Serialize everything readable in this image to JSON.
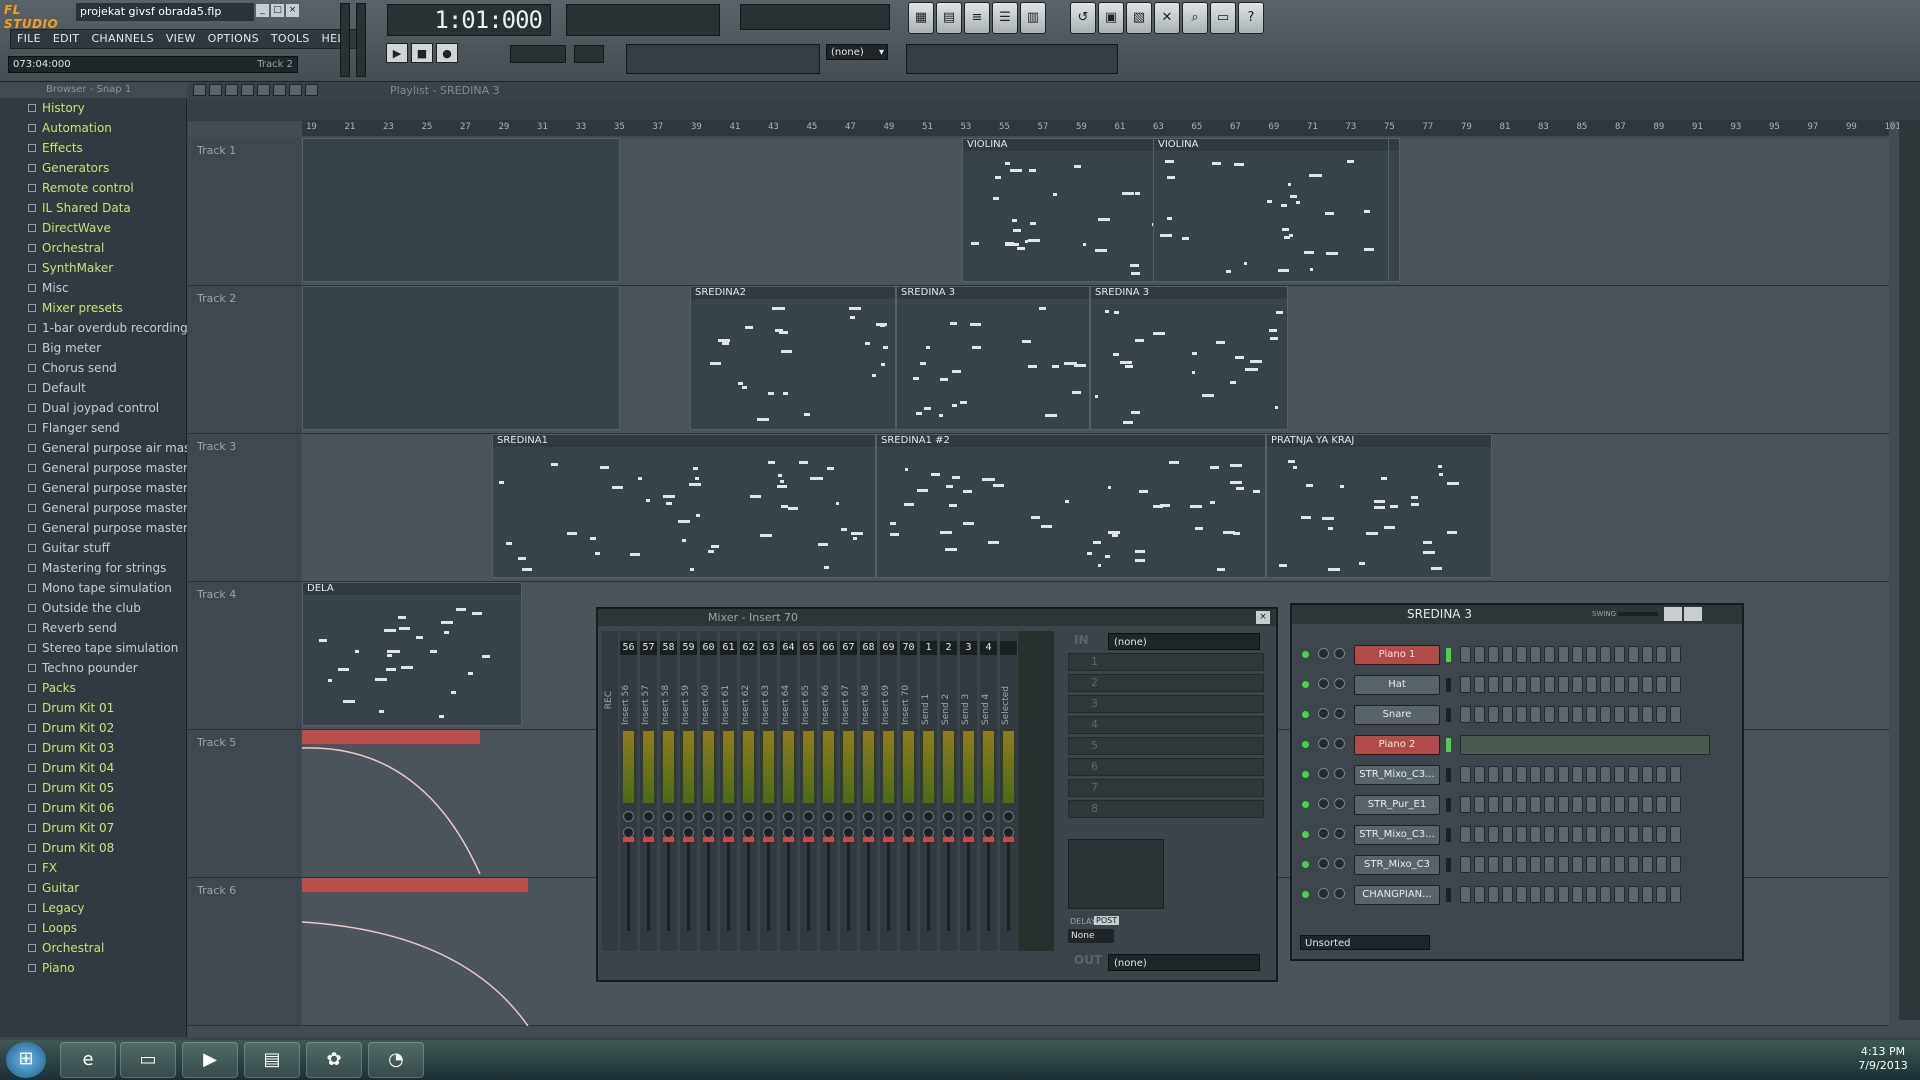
{
  "app": {
    "logo": "FL STUDIO",
    "file_title": "projekat givsf obrada5.flp",
    "window_buttons": [
      "_",
      "□",
      "×"
    ]
  },
  "menu": [
    "FILE",
    "EDIT",
    "CHANNELS",
    "VIEW",
    "OPTIONS",
    "TOOLS",
    "HELP"
  ],
  "hint_bar": {
    "value": "073:04:000",
    "track": "Track 2"
  },
  "clock": "1:01:000",
  "transport": {
    "play": "▶",
    "stop": "■",
    "record": "●"
  },
  "pattern_none": "(none)",
  "toolbar_icons": [
    "step-sequencer-icon",
    "piano-roll-icon",
    "playlist-icon",
    "browser-icon",
    "mixer-icon",
    "undo-icon",
    "save-icon",
    "render-icon",
    "plugin-icon",
    "search-icon",
    "project-icon",
    "help-icon"
  ],
  "browser": {
    "title": "Browser - Snap 1",
    "items": [
      {
        "label": "History",
        "type": "folder"
      },
      {
        "label": "Automation",
        "type": "folder"
      },
      {
        "label": "Effects",
        "type": "folder"
      },
      {
        "label": "Generators",
        "type": "folder"
      },
      {
        "label": "Remote control",
        "type": "folder"
      },
      {
        "label": "IL Shared Data",
        "type": "folder"
      },
      {
        "label": "DirectWave",
        "type": "folder"
      },
      {
        "label": "Orchestral",
        "type": "folder"
      },
      {
        "label": "SynthMaker",
        "type": "folder"
      },
      {
        "label": "Misc",
        "type": "item"
      },
      {
        "label": "Mixer presets",
        "type": "sel"
      },
      {
        "label": "1-bar overdub recording",
        "type": "item"
      },
      {
        "label": "Big meter",
        "type": "item"
      },
      {
        "label": "Chorus send",
        "type": "item"
      },
      {
        "label": "Default",
        "type": "item"
      },
      {
        "label": "Dual joypad control",
        "type": "item"
      },
      {
        "label": "Flanger send",
        "type": "item"
      },
      {
        "label": "General purpose air mas...",
        "type": "item"
      },
      {
        "label": "General purpose master...",
        "type": "item"
      },
      {
        "label": "General purpose master...",
        "type": "item"
      },
      {
        "label": "General purpose master...",
        "type": "item"
      },
      {
        "label": "General purpose master...",
        "type": "item"
      },
      {
        "label": "Guitar stuff",
        "type": "item"
      },
      {
        "label": "Mastering for strings",
        "type": "item"
      },
      {
        "label": "Mono tape simulation",
        "type": "item"
      },
      {
        "label": "Outside the club",
        "type": "item"
      },
      {
        "label": "Reverb send",
        "type": "item"
      },
      {
        "label": "Stereo tape simulation",
        "type": "item"
      },
      {
        "label": "Techno pounder",
        "type": "item"
      },
      {
        "label": "Packs",
        "type": "folder"
      },
      {
        "label": "Drum Kit 01",
        "type": "folder"
      },
      {
        "label": "Drum Kit 02",
        "type": "folder"
      },
      {
        "label": "Drum Kit 03",
        "type": "folder"
      },
      {
        "label": "Drum Kit 04",
        "type": "folder"
      },
      {
        "label": "Drum Kit 05",
        "type": "folder"
      },
      {
        "label": "Drum Kit 06",
        "type": "folder"
      },
      {
        "label": "Drum Kit 07",
        "type": "folder"
      },
      {
        "label": "Drum Kit 08",
        "type": "folder"
      },
      {
        "label": "FX",
        "type": "folder"
      },
      {
        "label": "Guitar",
        "type": "folder"
      },
      {
        "label": "Legacy",
        "type": "folder"
      },
      {
        "label": "Loops",
        "type": "folder"
      },
      {
        "label": "Orchestral",
        "type": "folder"
      },
      {
        "label": "Piano",
        "type": "folder"
      }
    ]
  },
  "playlist": {
    "title": "Playlist - SREDINA 3",
    "ruler": [
      "19",
      "21",
      "23",
      "25",
      "27",
      "29",
      "31",
      "33",
      "35",
      "37",
      "39",
      "41",
      "43",
      "45",
      "47",
      "49",
      "51",
      "53",
      "55",
      "57",
      "59",
      "61",
      "63",
      "65",
      "67",
      "69",
      "71",
      "73",
      "75",
      "77",
      "79",
      "81",
      "83",
      "85",
      "87",
      "89",
      "91",
      "93",
      "95",
      "97",
      "99",
      "101"
    ],
    "tracks": [
      "Track 1",
      "Track 2",
      "Track 3",
      "Track 4",
      "Track 5",
      "Track 6"
    ],
    "clips": [
      {
        "track": 0,
        "label": "VIOLINA"
      },
      {
        "track": 0,
        "label": "VIOLINA"
      },
      {
        "track": 1,
        "label": "SREDINA2"
      },
      {
        "track": 1,
        "label": "SREDINA 3"
      },
      {
        "track": 1,
        "label": "SREDINA 3"
      },
      {
        "track": 2,
        "label": "SREDINA1"
      },
      {
        "track": 2,
        "label": "SREDINA1 #2"
      },
      {
        "track": 2,
        "label": "PRATNJA YA KRAJ"
      },
      {
        "track": 3,
        "label": "DELA"
      }
    ]
  },
  "mixer": {
    "title": "Mixer - Insert 70",
    "rec_label": "REC",
    "strips": [
      {
        "num": "56",
        "name": "Insert 56"
      },
      {
        "num": "57",
        "name": "Insert 57"
      },
      {
        "num": "58",
        "name": "Insert 58"
      },
      {
        "num": "59",
        "name": "Insert 59"
      },
      {
        "num": "60",
        "name": "Insert 60"
      },
      {
        "num": "61",
        "name": "Insert 61"
      },
      {
        "num": "62",
        "name": "Insert 62"
      },
      {
        "num": "63",
        "name": "Insert 63"
      },
      {
        "num": "64",
        "name": "Insert 64"
      },
      {
        "num": "65",
        "name": "Insert 65"
      },
      {
        "num": "66",
        "name": "Insert 66"
      },
      {
        "num": "67",
        "name": "Insert 67"
      },
      {
        "num": "68",
        "name": "Insert 68"
      },
      {
        "num": "69",
        "name": "Insert 69"
      },
      {
        "num": "70",
        "name": "Insert 70"
      },
      {
        "num": "1",
        "name": "Send 1"
      },
      {
        "num": "2",
        "name": "Send 2"
      },
      {
        "num": "3",
        "name": "Send 3"
      },
      {
        "num": "4",
        "name": "Send 4"
      },
      {
        "num": "",
        "name": "Selected"
      }
    ],
    "in_label": "IN",
    "in_value": "(none)",
    "out_label": "OUT",
    "out_value": "(none)",
    "fx_slots": [
      "1",
      "2",
      "3",
      "4",
      "5",
      "6",
      "7",
      "8"
    ],
    "delay_label": "DELAY",
    "post_label": "POST",
    "delay_value": "None"
  },
  "rack": {
    "title": "SREDINA 3",
    "swing_label": "SWING",
    "channels": [
      {
        "name": "Piano 1",
        "active": true,
        "pattern": [
          0,
          0,
          0,
          0,
          0,
          0,
          0,
          0,
          0,
          0,
          0,
          0,
          0,
          0,
          0,
          0
        ]
      },
      {
        "name": "Hat",
        "active": false,
        "pattern": [
          0,
          0,
          0,
          0,
          0,
          0,
          0,
          0,
          0,
          0,
          0,
          0,
          0,
          0,
          0,
          0
        ]
      },
      {
        "name": "Snare",
        "active": false,
        "pattern": [
          0,
          0,
          0,
          0,
          0,
          0,
          0,
          0,
          0,
          0,
          0,
          0,
          0,
          0,
          0,
          0
        ]
      },
      {
        "name": "Piano 2",
        "active": true,
        "pattern": null
      },
      {
        "name": "STR_Mixo_C3...",
        "active": false,
        "pattern": [
          0,
          0,
          0,
          0,
          0,
          0,
          0,
          0,
          0,
          0,
          0,
          0,
          0,
          0,
          0,
          0
        ]
      },
      {
        "name": "STR_Pur_E1",
        "active": false,
        "pattern": [
          0,
          0,
          0,
          0,
          0,
          0,
          0,
          0,
          0,
          0,
          0,
          0,
          0,
          0,
          0,
          0
        ]
      },
      {
        "name": "STR_Mixo_C3...",
        "active": false,
        "pattern": [
          0,
          0,
          0,
          0,
          0,
          0,
          0,
          0,
          0,
          0,
          0,
          0,
          0,
          0,
          0,
          0
        ]
      },
      {
        "name": "STR_Mixo_C3",
        "active": false,
        "pattern": [
          0,
          0,
          0,
          0,
          0,
          0,
          0,
          0,
          0,
          0,
          0,
          0,
          0,
          0,
          0,
          0
        ]
      },
      {
        "name": "CHANGPIAN...",
        "active": false,
        "pattern": [
          0,
          0,
          0,
          0,
          0,
          0,
          0,
          0,
          0,
          0,
          0,
          0,
          0,
          0,
          0,
          0
        ]
      }
    ],
    "filter": "Unsorted"
  },
  "taskbar": {
    "apps": [
      "windows-start-icon",
      "internet-explorer-icon",
      "file-explorer-icon",
      "media-player-icon",
      "winrar-icon",
      "fl-studio-icon",
      "app-icon"
    ],
    "time": "4:13 PM",
    "date": "7/9/2013"
  }
}
